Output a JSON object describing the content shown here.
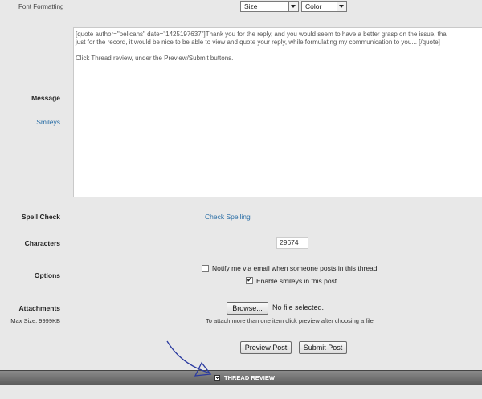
{
  "font_formatting": {
    "label": "Font Formatting",
    "size_select": "Size",
    "color_select": "Color"
  },
  "message": {
    "label": "Message",
    "smileys_link": "Smileys",
    "lines": [
      "[quote author=\"pelicans\" date=\"1425197637\"]Thank you for the reply, and you would seem to have a better grasp on the issue, tha",
      "just for the record, it would be nice to be able to view and quote your reply, while formulating my communication to you... [/quote]",
      "",
      "Click Thread review, under the Preview/Submit buttons."
    ]
  },
  "spell_check": {
    "label": "Spell Check",
    "link": "Check Spelling"
  },
  "characters": {
    "label": "Characters",
    "value": "29674"
  },
  "options": {
    "label": "Options",
    "notify_label": "Notify me via email when someone posts in this thread",
    "notify_checked": false,
    "smilies_label": "Enable smileys in this post",
    "smilies_checked": true
  },
  "attachments": {
    "label": "Attachments",
    "max_size": "Max Size: 9999KB",
    "browse_button": "Browse...",
    "no_file": "No file selected.",
    "hint": "To attach more than one item click preview after choosing a file"
  },
  "buttons": {
    "preview": "Preview Post",
    "submit": "Submit Post"
  },
  "thread_review": {
    "label": "THREAD REVIEW",
    "expand_icon": "plus-square-icon"
  },
  "annotation": {
    "color": "#2a3aa0"
  }
}
